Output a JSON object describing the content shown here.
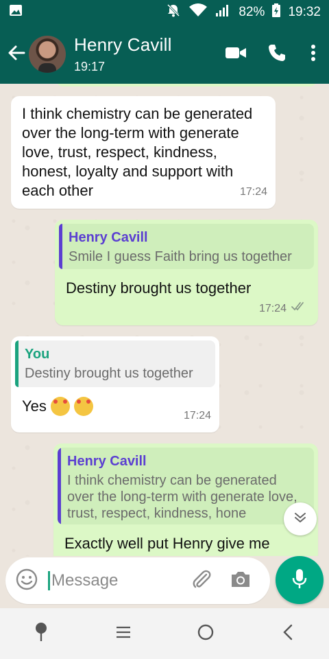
{
  "status_bar": {
    "battery_percent": "82%",
    "time": "19:32"
  },
  "header": {
    "contact_name": "Henry Cavill",
    "contact_status": "19:17"
  },
  "messages": [
    {
      "direction": "in",
      "text": "I think chemistry can be generated over the long-term with generate love, trust, respect, kindness, honest, loyalty and support with each other",
      "time": "17:24"
    },
    {
      "direction": "out",
      "quote_author": "Henry Cavill",
      "quote_text": "Smile I guess Faith bring us together",
      "text": "Destiny brought us together",
      "time": "17:24"
    },
    {
      "direction": "in",
      "quote_author": "You",
      "quote_text": "Destiny brought us together",
      "text": "Yes",
      "time": "17:24"
    },
    {
      "direction": "out",
      "quote_author": "Henry Cavill",
      "quote_text": "I think chemistry can be generated over the long-term with generate love, trust, respect, kindness, hone",
      "text": "Exactly well put Henry give me"
    }
  ],
  "composer": {
    "placeholder": "Message"
  },
  "colors": {
    "header": "#075e54",
    "outgoing_bubble": "#dcf8c6",
    "incoming_bubble": "#ffffff",
    "accent": "#00a884",
    "quote_henry": "#5b3fd1",
    "quote_you": "#1aa37e"
  },
  "icons": {
    "status_left": "image-icon",
    "notifications": "bell-off-icon",
    "wifi": "wifi-icon",
    "signal": "signal-icon",
    "battery": "battery-charging-icon",
    "back": "arrow-left-icon",
    "video": "video-camera-icon",
    "call": "phone-icon",
    "more": "more-vert-icon",
    "emoji": "emoji-icon",
    "attach": "paperclip-icon",
    "camera": "camera-icon",
    "mic": "mic-icon",
    "scroll_down": "chevron-double-down-icon",
    "nav_assistant": "pin-icon",
    "nav_menu": "menu-icon",
    "nav_home": "home-circle-icon",
    "nav_back": "nav-back-icon"
  }
}
